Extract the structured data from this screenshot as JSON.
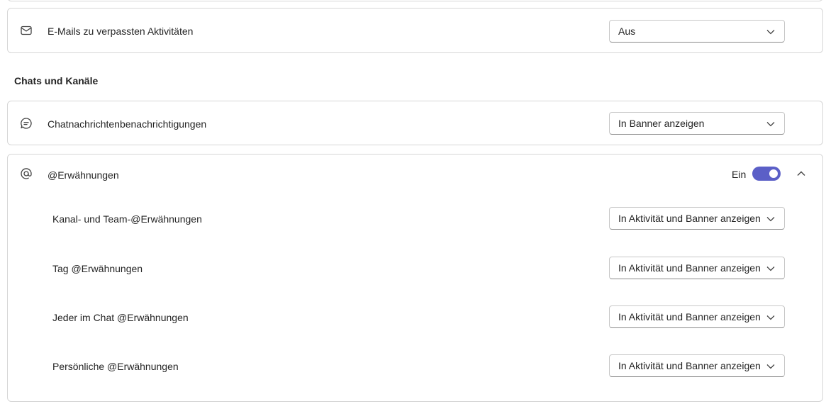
{
  "email_row": {
    "icon": "mail-icon",
    "label": "E-Mails zu verpassten Aktivitäten",
    "dropdown_value": "Aus"
  },
  "chats_section": {
    "heading": "Chats und Kanäle",
    "chat_row": {
      "icon": "chat-icon",
      "label": "Chatnachrichtenbenachrichtigungen",
      "dropdown_value": "In Banner anzeigen"
    },
    "mentions": {
      "icon": "at-icon",
      "label": "@Erwähnungen",
      "toggle_label": "Ein",
      "toggle_on": true,
      "accent_color": "#5b5fc7",
      "items": [
        {
          "label": "Kanal- und Team-@Erwähnungen",
          "dropdown_value": "In Aktivität und Banner anzeigen"
        },
        {
          "label": "Tag @Erwähnungen",
          "dropdown_value": "In Aktivität und Banner anzeigen"
        },
        {
          "label": "Jeder im Chat @Erwähnungen",
          "dropdown_value": "In Aktivität und Banner anzeigen"
        },
        {
          "label": "Persönliche @Erwähnungen",
          "dropdown_value": "In Aktivität und Banner anzeigen"
        }
      ]
    }
  }
}
